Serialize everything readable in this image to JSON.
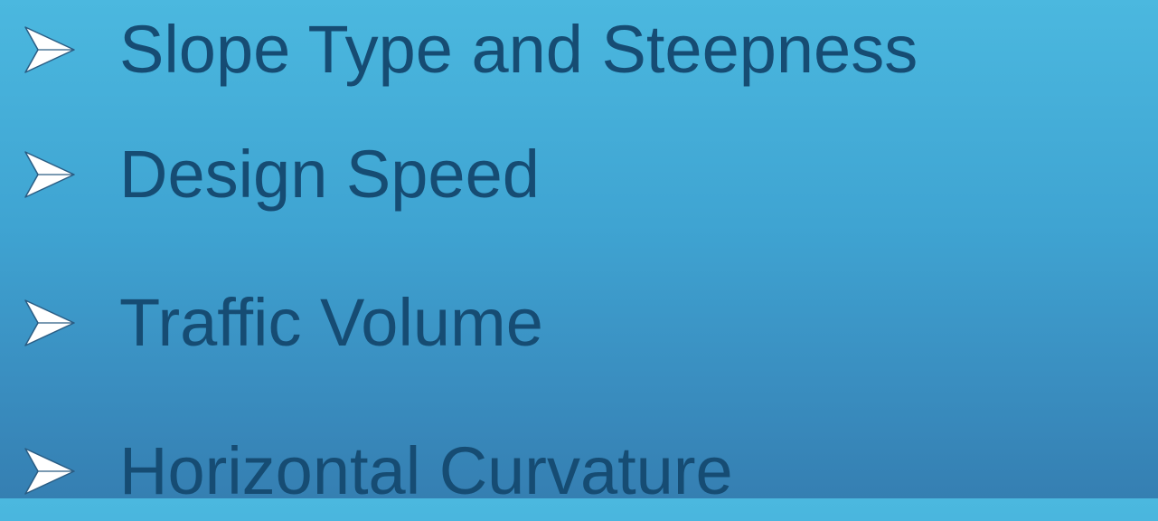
{
  "slide": {
    "bullets": [
      {
        "text": "Slope Type and Steepness",
        "icon": "arrowhead-bullet-icon"
      },
      {
        "text": "Design Speed",
        "icon": "arrowhead-bullet-icon"
      },
      {
        "text": "Traffic Volume",
        "icon": "arrowhead-bullet-icon"
      },
      {
        "text": "Horizontal Curvature",
        "icon": "arrowhead-bullet-icon"
      }
    ]
  },
  "colors": {
    "text": "#164c73",
    "bullet": "#ffffff",
    "background_top": "#4bb8df",
    "background_bottom": "#357fb2"
  }
}
